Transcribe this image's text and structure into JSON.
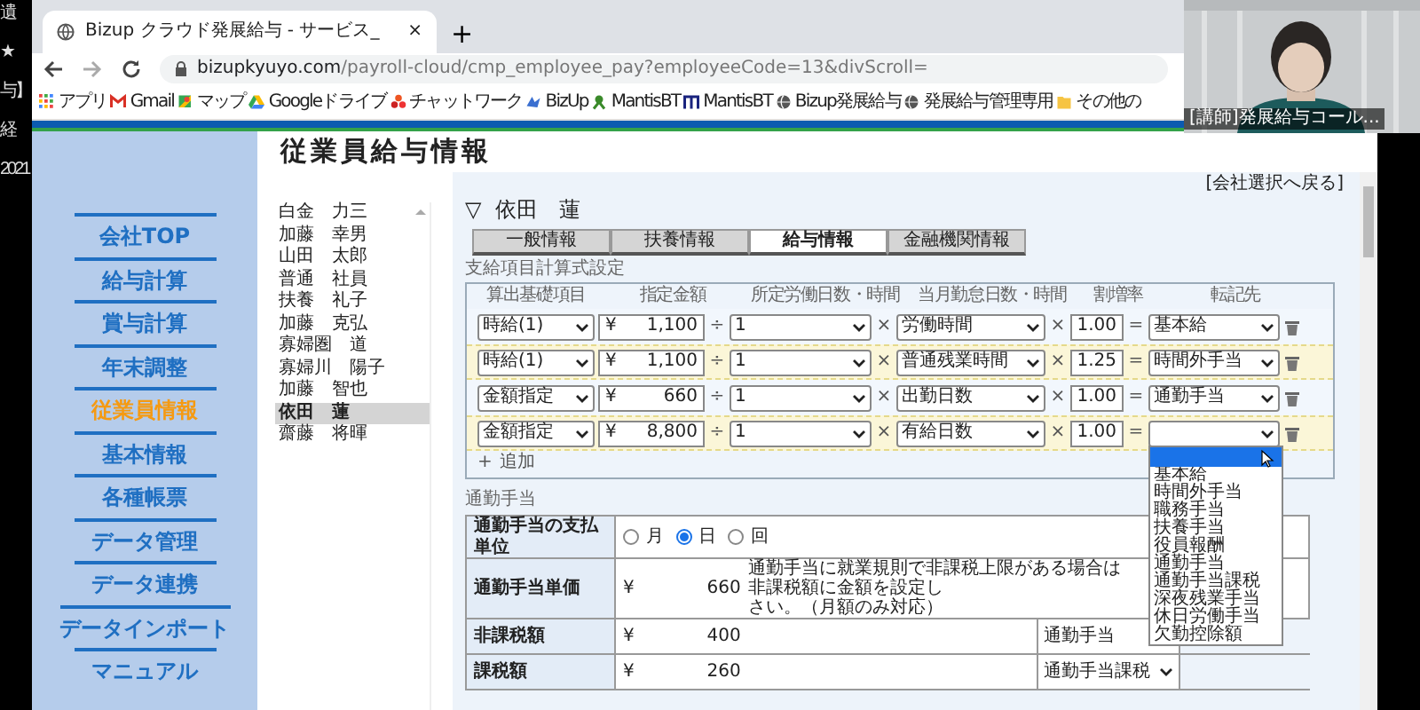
{
  "edge_texts": [
    "遺",
    "★",
    "与】",
    "経",
    "2021"
  ],
  "browser": {
    "tab_title": "Bizup クラウド発展給与 - サービス_",
    "tab_close": "×",
    "new_tab": "+",
    "url_host": "bizupkyuyo.com",
    "url_path": "/payroll-cloud/cmp_employee_pay?employeeCode=13&divScroll=",
    "bookmarks": [
      {
        "label": "アプリ",
        "kind": "apps"
      },
      {
        "label": "Gmail",
        "kind": "mail"
      },
      {
        "label": "マップ",
        "kind": "map"
      },
      {
        "label": "Googleドライブ",
        "kind": "drive"
      },
      {
        "label": "チャットワーク",
        "kind": "flower"
      },
      {
        "label": "BizUp",
        "kind": "bird"
      },
      {
        "label": "MantisBT",
        "kind": "mantis"
      },
      {
        "label": "MantisBT",
        "kind": "m"
      },
      {
        "label": "Bizup発展給与",
        "kind": "globe"
      },
      {
        "label": "発展給与管理専用",
        "kind": "globe"
      },
      {
        "label": "その他の",
        "kind": "folder"
      }
    ]
  },
  "webcam": {
    "caption": "[講師]発展給与コール..."
  },
  "app": {
    "title": "従業員給与情報",
    "back_link": "[会社選択へ戻る]",
    "menu": [
      {
        "label": "会社TOP",
        "selected": false
      },
      {
        "label": "給与計算",
        "selected": false
      },
      {
        "label": "賞与計算",
        "selected": false
      },
      {
        "label": "年末調整",
        "selected": false
      },
      {
        "label": "従業員情報",
        "selected": true
      },
      {
        "label": "基本情報",
        "selected": false
      },
      {
        "label": "各種帳票",
        "selected": false
      },
      {
        "label": "データ管理",
        "selected": false
      },
      {
        "label": "データ連携",
        "selected": false
      },
      {
        "label": "データインポート",
        "selected": false
      },
      {
        "label": "マニュアル",
        "selected": false
      }
    ],
    "employees": [
      {
        "name": "白金　力三",
        "selected": false
      },
      {
        "name": "加藤　幸男",
        "selected": false
      },
      {
        "name": "山田　太郎",
        "selected": false
      },
      {
        "name": "普通　社員",
        "selected": false
      },
      {
        "name": "扶養　礼子",
        "selected": false
      },
      {
        "name": "加藤　克弘",
        "selected": false
      },
      {
        "name": "寡婦圏　道",
        "selected": false
      },
      {
        "name": "寡婦川　陽子",
        "selected": false
      },
      {
        "name": "加藤　智也",
        "selected": false
      },
      {
        "name": "依田　蓮",
        "selected": true
      },
      {
        "name": "齋藤　将暉",
        "selected": false
      }
    ],
    "employee_header": {
      "toggle": "▽",
      "name": "依田　蓮"
    },
    "tabs": [
      {
        "label": "一般情報",
        "selected": false
      },
      {
        "label": "扶養情報",
        "selected": false
      },
      {
        "label": "給与情報",
        "selected": true
      },
      {
        "label": "金融機関情報",
        "selected": false
      }
    ],
    "formula": {
      "title": "支給項目計算式設定",
      "columns": [
        "算出基礎項目",
        "指定金額",
        "所定労働日数・時間",
        "当月勤怠日数・時間",
        "割増率",
        "転記先"
      ],
      "rows": [
        {
          "highlighted": false,
          "base": "時給(1)",
          "currency": "¥",
          "amount": "1,100",
          "operators": [
            "÷",
            "×",
            "×",
            "="
          ],
          "divisor": "1",
          "attendance": "労働時間",
          "rate": "1.00",
          "target": "基本給",
          "open": false
        },
        {
          "highlighted": true,
          "base": "時給(1)",
          "currency": "¥",
          "amount": "1,100",
          "operators": [
            "÷",
            "×",
            "×",
            "="
          ],
          "divisor": "1",
          "attendance": "普通残業時間",
          "rate": "1.25",
          "target": "時間外手当",
          "open": false
        },
        {
          "highlighted": false,
          "base": "金額指定",
          "currency": "¥",
          "amount": "660",
          "operators": [
            "÷",
            "×",
            "×",
            "="
          ],
          "divisor": "1",
          "attendance": "出勤日数",
          "rate": "1.00",
          "target": "通勤手当",
          "open": false
        },
        {
          "highlighted": true,
          "base": "金額指定",
          "currency": "¥",
          "amount": "8,800",
          "operators": [
            "÷",
            "×",
            "×",
            "="
          ],
          "divisor": "1",
          "attendance": "有給日数",
          "rate": "1.00",
          "open": true
        }
      ],
      "add": {
        "icon": "+",
        "label": "追加"
      }
    },
    "dropdown": {
      "options": [
        {
          "selected": true
        },
        {
          "label": "基本給",
          "selected": false
        },
        {
          "label": "時間外手当",
          "selected": false
        },
        {
          "label": "職務手当",
          "selected": false
        },
        {
          "label": "扶養手当",
          "selected": false
        },
        {
          "label": "役員報酬",
          "selected": false
        },
        {
          "label": "通勤手当",
          "selected": false
        },
        {
          "label": "通勤手当課税",
          "selected": false
        },
        {
          "label": "深夜残業手当",
          "selected": false
        },
        {
          "label": "休日労働手当",
          "selected": false
        },
        {
          "label": "欠勤控除額",
          "selected": false
        }
      ]
    },
    "commute": {
      "title": "通勤手当",
      "unit": {
        "label": "通勤手当の支払単位",
        "radios": [
          {
            "label": "月",
            "selected": false
          },
          {
            "label": "日",
            "selected": true
          },
          {
            "label": "回",
            "selected": false
          }
        ]
      },
      "price": {
        "label": "通勤手当単価",
        "currency": "¥",
        "amount": "660",
        "note_lines": [
          "通勤手当に就業規則で非課税上限がある場合は非課税額に金額を設定し",
          "さい。（月額のみ対応）"
        ]
      },
      "nontaxable": {
        "label": "非課税額",
        "currency": "¥",
        "amount": "400",
        "target": "通勤手当"
      },
      "taxable": {
        "label": "課税額",
        "currency": "¥",
        "amount": "260",
        "target": "通勤手当課税"
      }
    }
  }
}
